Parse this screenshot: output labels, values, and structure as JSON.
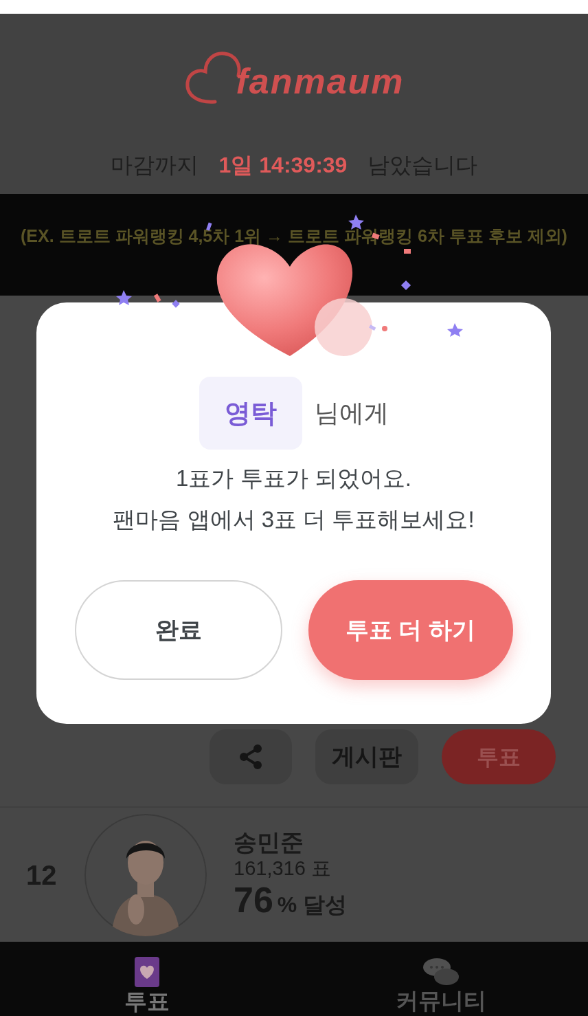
{
  "logo": {
    "text": "fanmaum"
  },
  "countdown": {
    "prefix": "마감까지",
    "time": "1일 14:39:39",
    "suffix": "남았습니다"
  },
  "notice": "(EX.  트로트 파워랭킹 4,5차 1위 → 트로트 파워랭킹 6차 투표 후보 제외)",
  "card_actions": {
    "board": "게시판",
    "vote": "투표"
  },
  "ranking": [
    {
      "rank": "12",
      "name": "송민준",
      "votes": "161,316 표",
      "percent": "76",
      "percent_label": "% 달성"
    }
  ],
  "dialog": {
    "recipient": "영탁",
    "recipient_suffix": "님에게",
    "message": [
      "1표가 투표가 되었어요.",
      "팬마음 앱에서 3표 더 투표해보세요!"
    ],
    "buttons": [
      {
        "label": "완료",
        "kind": "secondary"
      },
      {
        "label": "투표 더 하기",
        "kind": "primary"
      }
    ]
  },
  "tabs": [
    {
      "label": "투표",
      "selected": true
    },
    {
      "label": "커뮤니티",
      "selected": false
    }
  ]
}
